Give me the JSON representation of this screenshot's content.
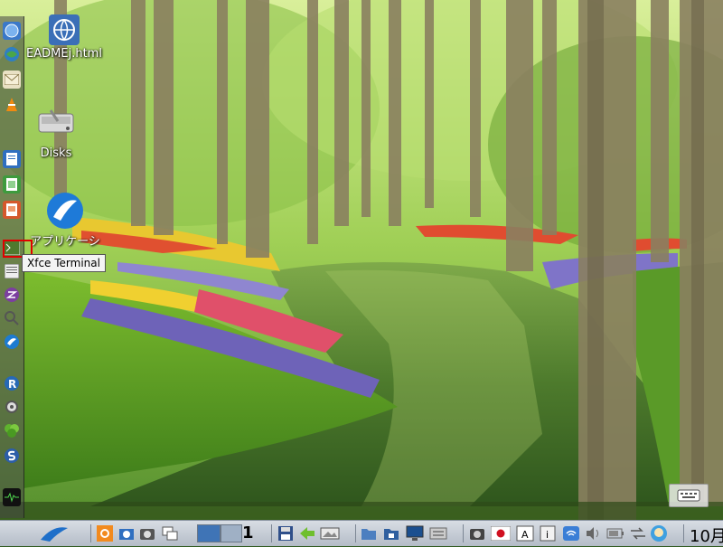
{
  "desktop": {
    "icons": [
      {
        "label": "EADMEj.html",
        "icon": "html-file-icon"
      },
      {
        "label": "Disks",
        "icon": "disks-icon"
      },
      {
        "label": "アプリケーシ",
        "icon": "lxqt-app-menu-icon"
      }
    ],
    "tooltip": "Xfce Terminal"
  },
  "dock": {
    "items": [
      "browser-icon",
      "globe-icon",
      "mail-icon",
      "vlc-icon",
      "document-icon",
      "spreadsheet-icon",
      "presentation-icon",
      "terminal-icon",
      "text-editor-icon",
      "emacs-icon",
      "search-icon",
      "bird-icon",
      "r-icon",
      "settings-icon",
      "leaf-icon",
      "s-icon",
      "system-monitor-icon"
    ]
  },
  "taskbar": {
    "workspace_number": "1",
    "clock": "10月",
    "items": [
      "app-menu-icon",
      "settings-icon",
      "screenshot-icon",
      "camera-icon",
      "windows-icon",
      "pager",
      "save-icon",
      "back-arrow-icon",
      "image-viewer-icon",
      "file-manager-icon",
      "folder-icon",
      "monitor-icon",
      "keyboard-icon",
      "camera-icon-2",
      "japan-flag-icon",
      "text-input-icon",
      "info-icon",
      "wifi-icon",
      "volume-icon",
      "battery-icon",
      "network-icon",
      "user-icon"
    ]
  },
  "colors": {
    "taskbar_bg": "#c6cdd6",
    "highlight": "#e00000",
    "tooltip_bg": "#f4f4f4"
  }
}
